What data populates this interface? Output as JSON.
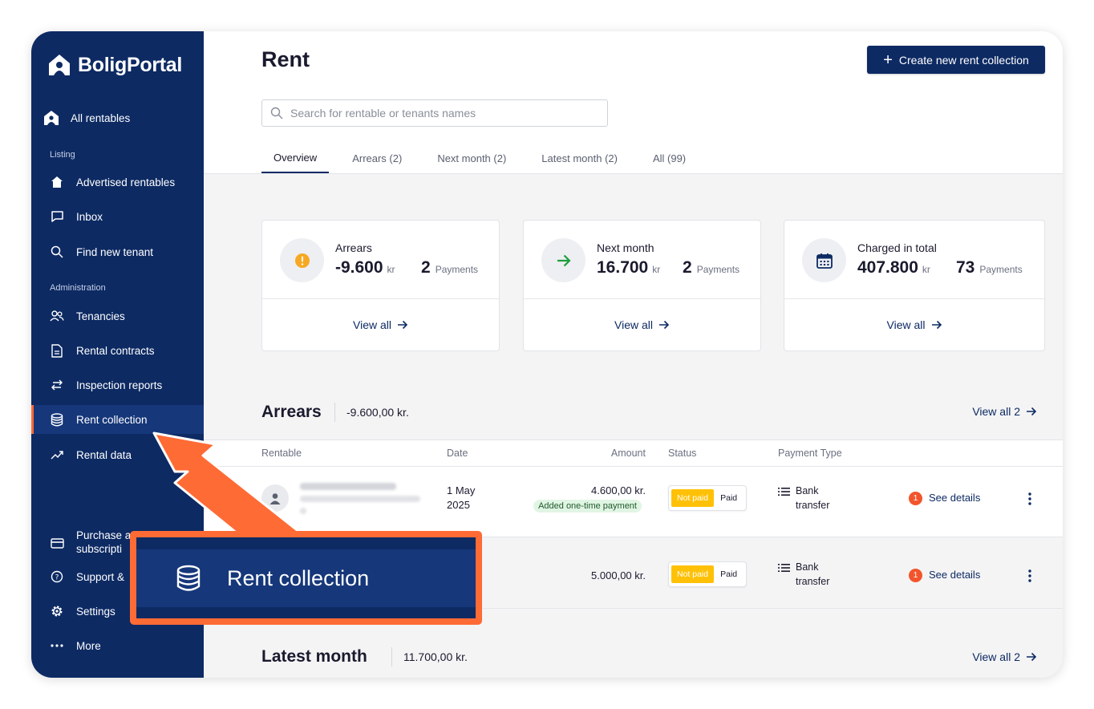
{
  "app": {
    "logo_text": "BoligPortal"
  },
  "sidebar": {
    "all_rentables": "All rentables",
    "section_listing": "Listing",
    "section_admin": "Administration",
    "items": [
      {
        "label": "Advertised rentables",
        "icon": "house-icon"
      },
      {
        "label": "Inbox",
        "icon": "chat-icon"
      },
      {
        "label": "Find new tenant",
        "icon": "search-icon"
      },
      {
        "label": "Tenancies",
        "icon": "people-icon"
      },
      {
        "label": "Rental contracts",
        "icon": "document-icon"
      },
      {
        "label": "Inspection reports",
        "icon": "swap-arrows-icon"
      },
      {
        "label": "Rent collection",
        "icon": "database-icon"
      },
      {
        "label": "Rental data",
        "icon": "trend-icon"
      }
    ],
    "bottom_items": [
      {
        "label": "Purchase a subscription",
        "icon": "card-icon"
      },
      {
        "label": "Support & help",
        "icon": "help-icon"
      },
      {
        "label": "Settings",
        "icon": "gear-icon"
      },
      {
        "label": "More",
        "icon": "more-icon"
      }
    ],
    "visible_labels": {
      "purchase_line1": "Purchase a",
      "purchase_line2": "subscripti",
      "support": "Support &"
    }
  },
  "header": {
    "title": "Rent",
    "create_button": "Create new rent collection",
    "search_placeholder": "Search for rentable or tenants names",
    "tabs": [
      "Overview",
      "Arrears (2)",
      "Next month (2)",
      "Latest month (2)",
      "All (99)"
    ]
  },
  "cards": [
    {
      "title": "Arrears",
      "amount": "-9.600",
      "currency": "kr",
      "count": "2",
      "count_label": "Payments",
      "link": "View all"
    },
    {
      "title": "Next month",
      "amount": "16.700",
      "currency": "kr",
      "count": "2",
      "count_label": "Payments",
      "link": "View all"
    },
    {
      "title": "Charged in total",
      "amount": "407.800",
      "currency": "kr",
      "count": "73",
      "count_label": "Payments",
      "link": "View all"
    }
  ],
  "arrears": {
    "title": "Arrears",
    "sum": "-9.600,00 kr.",
    "link": "View all 2",
    "columns": [
      "Rentable",
      "Date",
      "Amount",
      "Status",
      "Payment Type"
    ],
    "rows": [
      {
        "date": "1 May 2025",
        "amount": "4.600,00 kr.",
        "tag": "Added one-time payment",
        "status_not_paid": "Not paid",
        "status_paid": "Paid",
        "payment_type": "Bank transfer",
        "badge": "1",
        "details": "See details"
      },
      {
        "date": "",
        "amount": "5.000,00 kr.",
        "tag": "",
        "status_not_paid": "Not paid",
        "status_paid": "Paid",
        "payment_type": "Bank transfer",
        "badge": "1",
        "details": "See details"
      }
    ]
  },
  "latest_month": {
    "title": "Latest month",
    "sum": "11.700,00 kr.",
    "link": "View all 2"
  },
  "callout": {
    "label": "Rent collection",
    "icon": "database-icon"
  },
  "colors": {
    "sidebar": "#0d2a63",
    "active": "#16377a",
    "accent": "#ff6b35",
    "warning": "#ffc107",
    "success": "#1e9e3e"
  }
}
